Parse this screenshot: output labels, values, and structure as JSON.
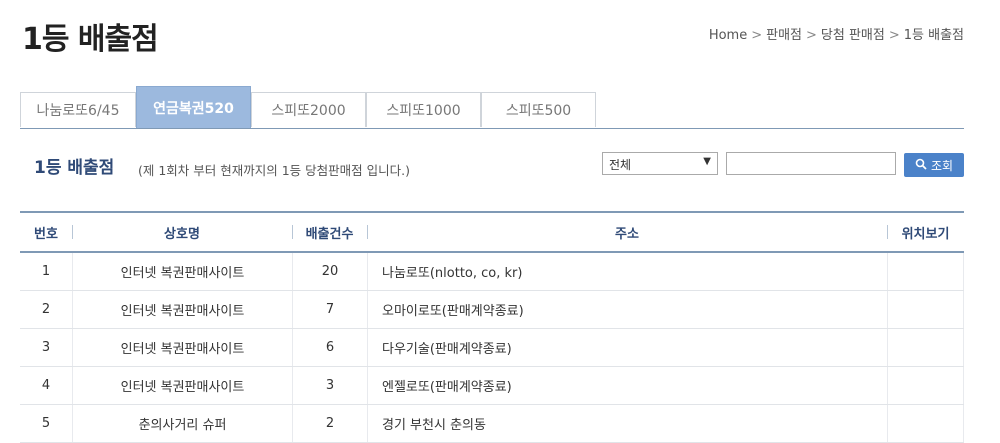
{
  "page": {
    "title": "1등 배출점",
    "breadcrumb": [
      "Home",
      "판매점",
      "당첨 판매점",
      "1등 배출점"
    ]
  },
  "tabs": [
    {
      "label": "나눔로또6/45",
      "active": false
    },
    {
      "label": "연금복권520",
      "active": true
    },
    {
      "label": "스피또2000",
      "active": false
    },
    {
      "label": "스피또1000",
      "active": false
    },
    {
      "label": "스피또500",
      "active": false
    }
  ],
  "section": {
    "title": "1등 배출점",
    "description": "(제 1회차 부터 현재까지의 1등 당첨판매점 입니다.)"
  },
  "search": {
    "region_select": "전체",
    "keyword_value": "",
    "button_label": "조회"
  },
  "table": {
    "headers": [
      "번호",
      "상호명",
      "배출건수",
      "주소",
      "위치보기"
    ],
    "rows": [
      {
        "no": "1",
        "name": "인터넷 복권판매사이트",
        "count": "20",
        "address": "나눔로또(nlotto, co, kr)"
      },
      {
        "no": "2",
        "name": "인터넷 복권판매사이트",
        "count": "7",
        "address": "오마이로또(판매계약종료)"
      },
      {
        "no": "3",
        "name": "인터넷 복권판매사이트",
        "count": "6",
        "address": "다우기술(판매계약종료)"
      },
      {
        "no": "4",
        "name": "인터넷 복권판매사이트",
        "count": "3",
        "address": "엔젤로또(판매계약종료)"
      },
      {
        "no": "5",
        "name": "춘의사거리 슈퍼",
        "count": "2",
        "address": "경기 부천시 춘의동"
      }
    ]
  },
  "colors": {
    "accent": "#4b82c9",
    "tab_active": "#9cb9de",
    "header_text": "#2f4a77",
    "rule": "#7f99b5"
  }
}
